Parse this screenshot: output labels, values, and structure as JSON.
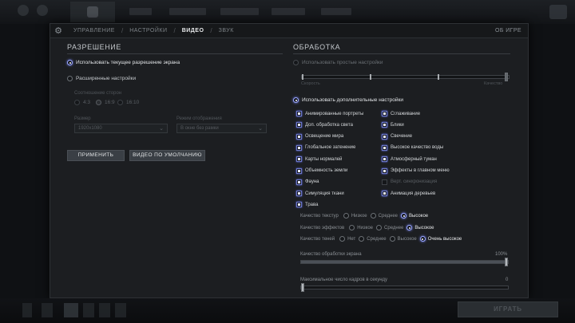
{
  "tabs": {
    "items": [
      "УПРАВЛЕНИЕ",
      "НАСТРОЙКИ",
      "ВИДЕО",
      "ЗВУК"
    ],
    "active": "ВИДЕО",
    "about": "ОБ ИГРЕ"
  },
  "resolution": {
    "title": "РАЗРЕШЕНИЕ",
    "use_current": "Использовать текущее разрешение экрана",
    "advanced": "Расширенные настройки",
    "aspect_label": "Соотношение сторон",
    "aspects": [
      "4:3",
      "16:9",
      "16:10"
    ],
    "aspect_selected": "16:9",
    "size_label": "Размер",
    "size_value": "1920x1080",
    "mode_label": "Режим отображения",
    "mode_value": "В окне без рамки",
    "apply": "ПРИМЕНИТЬ",
    "default": "ВИДЕО ПО УМОЛЧАНИЮ"
  },
  "processing": {
    "title": "ОБРАБОТКА",
    "simple": "Использовать простые настройки",
    "simple_left": "Скорость",
    "simple_right": "Качество",
    "advanced": "Использовать дополнительные настройки",
    "checkboxes_left": [
      {
        "label": "Анимированные портреты",
        "checked": true
      },
      {
        "label": "Доп. обработка света",
        "checked": true
      },
      {
        "label": "Освещение мира",
        "checked": true
      },
      {
        "label": "Глобальное затенение",
        "checked": true
      },
      {
        "label": "Карты нормалей",
        "checked": true
      },
      {
        "label": "Объемность земли",
        "checked": true
      },
      {
        "label": "Фауна",
        "checked": true
      },
      {
        "label": "Симуляция ткани",
        "checked": true
      },
      {
        "label": "Трава",
        "checked": true
      }
    ],
    "checkboxes_right": [
      {
        "label": "Сглаживание",
        "checked": true
      },
      {
        "label": "Блики",
        "checked": true
      },
      {
        "label": "Свечение",
        "checked": true
      },
      {
        "label": "Высокое качество воды",
        "checked": true
      },
      {
        "label": "Атмосферный туман",
        "checked": true
      },
      {
        "label": "Эффекты в главном меню",
        "checked": true
      },
      {
        "label": "Верт. синхронизация",
        "checked": false,
        "disabled": true
      },
      {
        "label": "Анимация деревьев",
        "checked": true
      }
    ],
    "texture": {
      "label": "Качество текстур",
      "options": [
        "Низкое",
        "Среднее",
        "Высокое"
      ],
      "selected": "Высокое"
    },
    "effects": {
      "label": "Качество эффектов",
      "options": [
        "Низкое",
        "Среднее",
        "Высокое"
      ],
      "selected": "Высокое"
    },
    "shadows": {
      "label": "Качество теней",
      "options": [
        "Нет",
        "Среднее",
        "Высокое",
        "Очень высокое"
      ],
      "selected": "Очень высокое"
    },
    "render_quality": {
      "label": "Качество обработки экрана",
      "value": "100%",
      "fraction": 1.0
    },
    "fps": {
      "label": "Максимальное число кадров в секунду",
      "value": "0",
      "fraction": 0.0
    }
  },
  "bottom": {
    "play": "ИГРАТЬ"
  }
}
